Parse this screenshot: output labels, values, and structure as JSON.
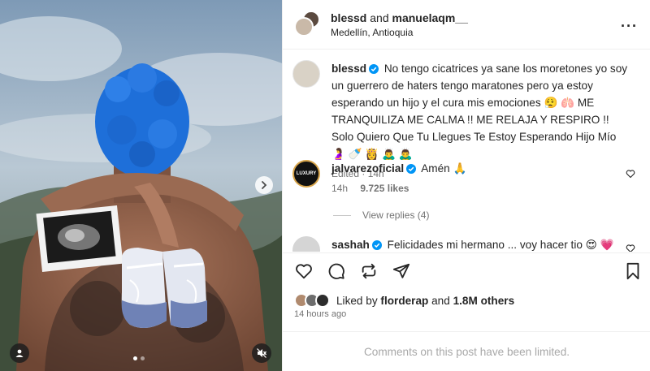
{
  "header": {
    "user1": "blessd",
    "joiner": "and",
    "user2": "manuelaqm__",
    "location": "Medellín, Antioquia",
    "more_icon": "more-horizontal-icon"
  },
  "caption": {
    "username": "blessd",
    "text": "No tengo cicatrices ya sane los moretones yo soy un guerrero de haters tengo maratones pero ya estoy esperando un hijo y el cura mis emociones 😮‍💨 🫁 ME TRANQUILIZA ME CALMA !! ME RELAJA Y RESPIRO !! Solo Quiero Que Tu Llegues Te Estoy Esperando Hijo Mío 🤰 🍼 👸 🙇‍♂️ 🙇‍♂️",
    "edited": "Edited",
    "time": "14h"
  },
  "comments": [
    {
      "username": "jalvarezoficial",
      "avatar_text": "LUXURY",
      "text": "Amén 🙏",
      "time": "14h",
      "likes": "9.725 likes",
      "replies": "View replies (4)"
    },
    {
      "username": "sashah",
      "text": "Felicidades mi hermano ... voy hacer tio 😍 💗"
    }
  ],
  "footer": {
    "liked_prefix": "Liked by",
    "liked_user": "florderap",
    "liked_and": "and",
    "liked_count": "1.8M others",
    "time_ago": "14 hours ago",
    "comments_limited": "Comments on this post have been limited."
  },
  "media": {
    "carousel_total": 2,
    "carousel_active": 1
  },
  "colors": {
    "verified": "#0095f6",
    "text": "#262626",
    "muted": "#737373",
    "hair": "#1e6fd9"
  }
}
